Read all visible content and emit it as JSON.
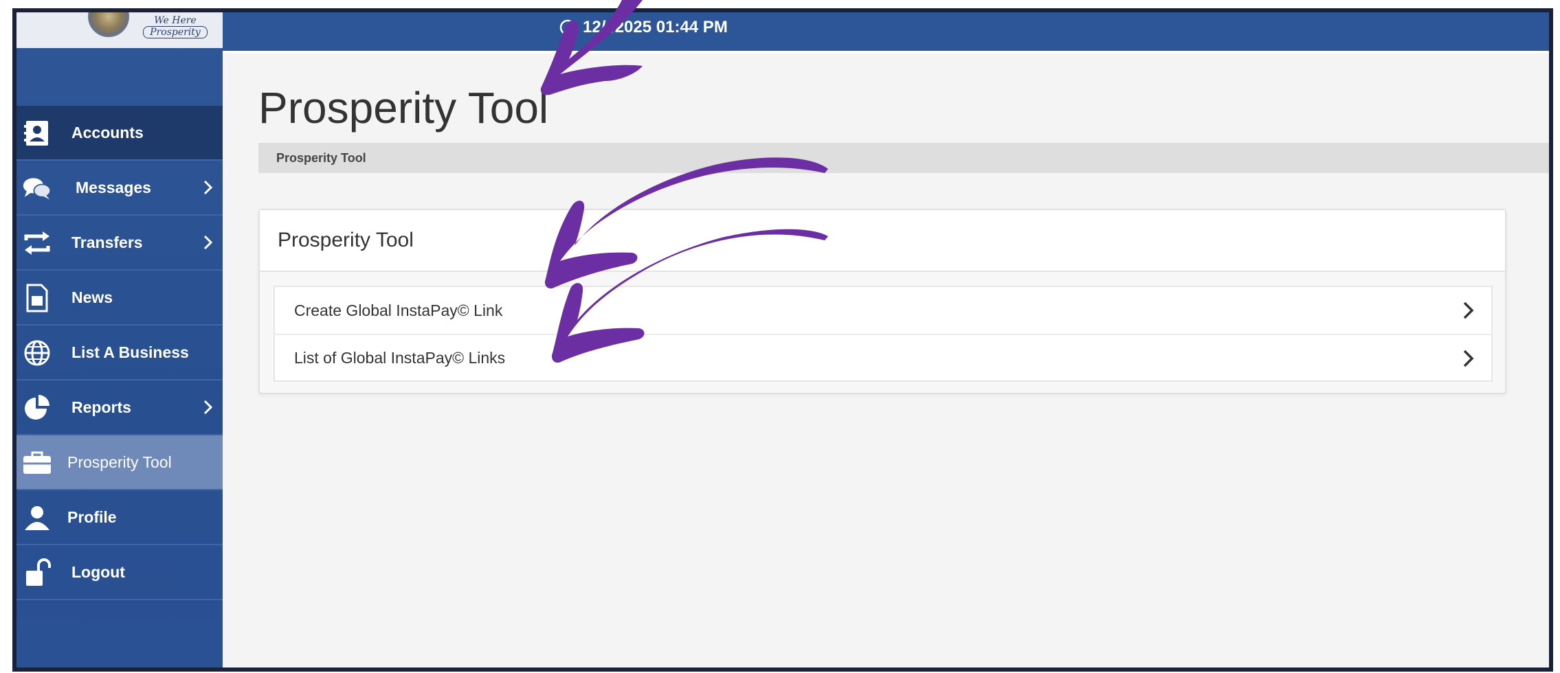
{
  "app": {
    "logo": {
      "line1": "We Here",
      "line2": "Prosperity"
    },
    "topbar_time": "12/  /2025 01:44 PM"
  },
  "sidebar": {
    "items": [
      {
        "label": "Accounts",
        "icon": "address-book-icon",
        "chevron": false,
        "state": "dark"
      },
      {
        "label": "Messages",
        "icon": "chat-bubbles-icon",
        "chevron": true,
        "state": "normal"
      },
      {
        "label": "Transfers",
        "icon": "transfer-arrows-icon",
        "chevron": true,
        "state": "normal"
      },
      {
        "label": "News",
        "icon": "document-icon",
        "chevron": false,
        "state": "normal"
      },
      {
        "label": "List A Business",
        "icon": "globe-icon",
        "chevron": false,
        "state": "normal"
      },
      {
        "label": "Reports",
        "icon": "pie-chart-icon",
        "chevron": true,
        "state": "normal"
      },
      {
        "label": "Prosperity Tool",
        "icon": "briefcase-icon",
        "chevron": false,
        "state": "active"
      },
      {
        "label": "Profile",
        "icon": "user-icon",
        "chevron": false,
        "state": "normal"
      },
      {
        "label": "Logout",
        "icon": "unlocked-padlock-icon",
        "chevron": false,
        "state": "normal"
      }
    ]
  },
  "main": {
    "title": "Prosperity Tool",
    "breadcrumb": "Prosperity Tool",
    "panel": {
      "header": "Prosperity Tool",
      "rows": [
        {
          "label": "Create Global InstaPay© Link",
          "icon": "chevron-right-icon"
        },
        {
          "label": "List of Global InstaPay© Links",
          "icon": "chevron-right-icon"
        }
      ]
    }
  },
  "colors": {
    "sidebar_blue": "#2f5798",
    "sidebar_dark": "#1d3a6a",
    "sidebar_active": "#6f8ab8",
    "topbar_blue": "#2d5699",
    "annotation_purple": "#6c2fa3"
  }
}
